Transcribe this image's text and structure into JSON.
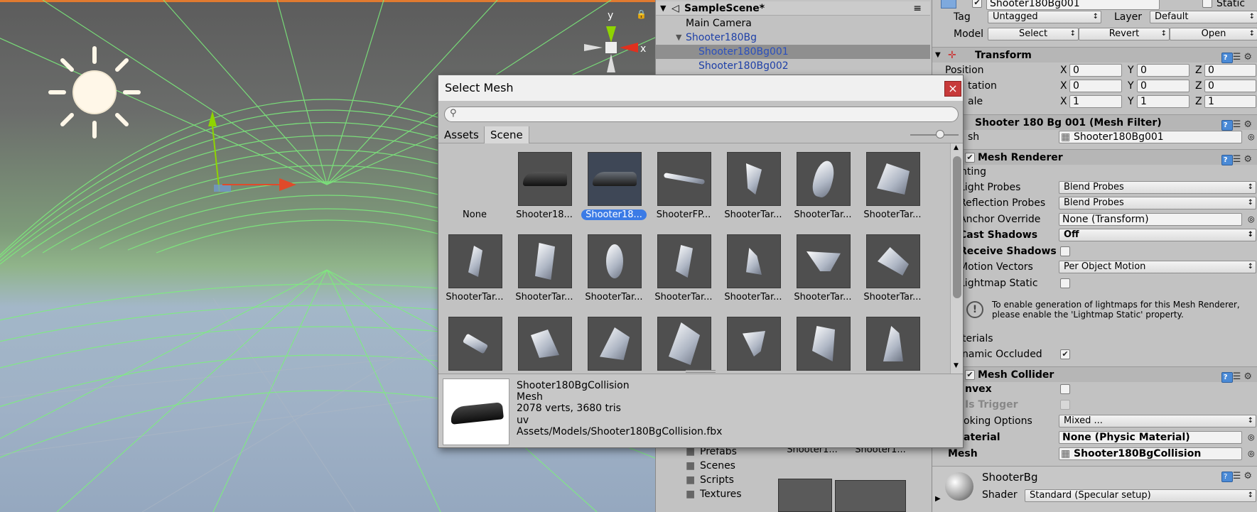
{
  "scene_view": {
    "gizmo": {
      "y_label": "y",
      "x_label": "x"
    }
  },
  "hierarchy": {
    "scene_name": "SampleScene*",
    "items": [
      {
        "label": "Main Camera"
      },
      {
        "label": "Shooter180Bg"
      },
      {
        "label": "Shooter180Bg001"
      },
      {
        "label": "Shooter180Bg002"
      }
    ],
    "project_folders": [
      "Prefabs",
      "Scenes",
      "Scripts",
      "Textures"
    ],
    "project_assets": [
      "Shooter1...",
      "Shooter1..."
    ]
  },
  "inspector": {
    "object_name": "Shooter180Bg001",
    "static_label": "Static",
    "tag_label": "Tag",
    "tag_value": "Untagged",
    "layer_label": "Layer",
    "layer_value": "Default",
    "model_label": "Model",
    "model_buttons": [
      "Select",
      "Revert",
      "Open"
    ],
    "transform": {
      "title": "Transform",
      "rows": [
        {
          "label": "Position",
          "x": "0",
          "y": "0",
          "z": "0"
        },
        {
          "label": "tation",
          "x": "0",
          "y": "0",
          "z": "0"
        },
        {
          "label": "ale",
          "x": "1",
          "y": "1",
          "z": "1"
        }
      ],
      "axis": [
        "X",
        "Y",
        "Z"
      ]
    },
    "mesh_filter": {
      "title": "Shooter 180 Bg 001 (Mesh Filter)",
      "mesh_label": "sh",
      "mesh_value": "Shooter180Bg001"
    },
    "mesh_renderer": {
      "title": "Mesh Renderer",
      "lighting_label": "hting",
      "light_probes_label": "Light Probes",
      "light_probes_value": "Blend Probes",
      "reflection_probes_label": "Reflection Probes",
      "reflection_probes_value": "Blend Probes",
      "anchor_override_label": "Anchor Override",
      "anchor_override_value": "None (Transform)",
      "cast_shadows_label": "Cast Shadows",
      "cast_shadows_value": "Off",
      "receive_shadows_label": "Receive Shadows",
      "motion_vectors_label": "Motion Vectors",
      "motion_vectors_value": "Per Object Motion",
      "lightmap_static_label": "Lightmap Static",
      "info_line1": "To enable generation of lightmaps for this Mesh Renderer,",
      "info_line2": "please enable the 'Lightmap Static' property.",
      "materials_label": "terials",
      "dynamic_occluded_label": "namic Occluded"
    },
    "mesh_collider": {
      "title": "Mesh Collider",
      "convex_label": "nvex",
      "is_trigger_label": "Is Trigger",
      "cooking_label": "oking Options",
      "cooking_value": "Mixed ...",
      "material_label": "aterial",
      "material_value": "None (Physic Material)",
      "mesh_label": "Mesh",
      "mesh_value": "Shooter180BgCollision"
    },
    "material": {
      "name": "ShooterBg",
      "shader_label": "Shader",
      "shader_value": "Standard (Specular setup)"
    }
  },
  "dialog": {
    "title": "Select Mesh",
    "close_label": "×",
    "search_value": "",
    "tabs": [
      "Assets",
      "Scene"
    ],
    "items": [
      "None",
      "Shooter18...",
      "Shooter18...",
      "ShooterFP...",
      "ShooterTar...",
      "ShooterTar...",
      "ShooterTar...",
      "ShooterTar...",
      "ShooterTar...",
      "ShooterTar...",
      "ShooterTar...",
      "ShooterTar...",
      "ShooterTar...",
      "ShooterTar...",
      "",
      "",
      "",
      "",
      "",
      "",
      ""
    ],
    "preview": {
      "name": "Shooter180BgCollision",
      "type": "Mesh",
      "stats": "2078 verts, 3680 tris",
      "channels": "uv",
      "path": "Assets/Models/Shooter180BgCollision.fbx"
    }
  }
}
